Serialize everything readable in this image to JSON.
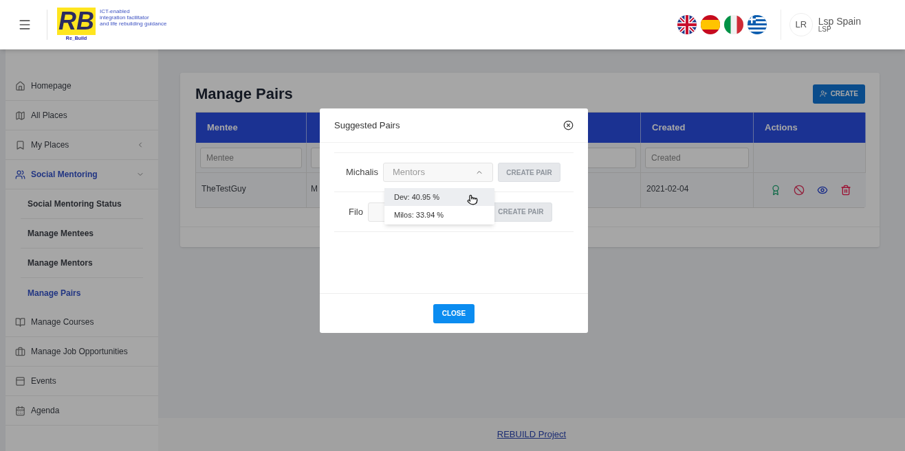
{
  "header": {
    "logo": {
      "letters": "RB",
      "name": "Re_Build",
      "tagline": [
        "ICT-enabled",
        "integration facilitator",
        "and life rebuilding guidance"
      ]
    },
    "languages": [
      {
        "kind": "uk"
      },
      {
        "kind": "es"
      },
      {
        "kind": "it"
      },
      {
        "kind": "gr"
      }
    ],
    "user": {
      "initials": "LR",
      "name": "Lsp Spain",
      "role": "LSP"
    }
  },
  "sidebar": {
    "items": [
      {
        "label": "Homepage",
        "selected": false
      },
      {
        "label": "All Places",
        "selected": false
      },
      {
        "label": "My Places",
        "selected": false,
        "expanded": false
      },
      {
        "label": "Social Mentoring",
        "selected": true,
        "expanded": true,
        "children": [
          {
            "label": "Social Mentoring Status",
            "selected": false
          },
          {
            "label": "Manage Mentees",
            "selected": false
          },
          {
            "label": "Manage Mentors",
            "selected": false
          },
          {
            "label": "Manage Pairs",
            "selected": true
          }
        ]
      },
      {
        "label": "Manage Courses",
        "selected": false
      },
      {
        "label": "Manage Job Opportunities",
        "selected": false
      },
      {
        "label": "Events",
        "selected": false
      },
      {
        "label": "Agenda",
        "selected": false
      }
    ]
  },
  "page": {
    "title": "Manage Pairs",
    "create_button": "CREATE",
    "table": {
      "columns": [
        {
          "label": "Mentee",
          "filter_placeholder": "Mentee"
        },
        {
          "kind": "hidden"
        },
        {
          "label": "Created",
          "filter_placeholder": "Created"
        },
        {
          "label": "Actions"
        }
      ],
      "rows": [
        {
          "cells": [
            "TheTestGuy",
            "M",
            "2021-02-04"
          ],
          "actions": [
            {
              "kind": "award"
            },
            {
              "kind": "ban"
            },
            {
              "kind": "view"
            },
            {
              "kind": "delete"
            }
          ]
        }
      ]
    }
  },
  "footer": {
    "link": "REBUILD Project"
  },
  "modal": {
    "title": "Suggested Pairs",
    "pairs": [
      {
        "mentee": "Michalis",
        "placeholder": "Mentors",
        "open": true,
        "button": "CREATE PAIR",
        "disabled": true,
        "options": [
          {
            "label": "Dev: 40.95 %",
            "highlighted": true
          },
          {
            "label": "Milos: 33.94 %",
            "highlighted": false
          }
        ]
      },
      {
        "mentee": "Filo",
        "open": false,
        "button": "CREATE PAIR",
        "disabled": true
      }
    ],
    "close_button": "CLOSE"
  }
}
